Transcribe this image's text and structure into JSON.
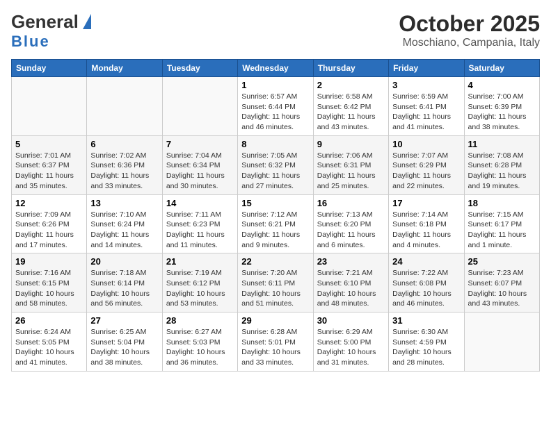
{
  "header": {
    "logo_general": "General",
    "logo_blue": "Blue",
    "month_title": "October 2025",
    "location": "Moschiano, Campania, Italy"
  },
  "weekdays": [
    "Sunday",
    "Monday",
    "Tuesday",
    "Wednesday",
    "Thursday",
    "Friday",
    "Saturday"
  ],
  "weeks": [
    [
      {
        "day": "",
        "sunrise": "",
        "sunset": "",
        "daylight": ""
      },
      {
        "day": "",
        "sunrise": "",
        "sunset": "",
        "daylight": ""
      },
      {
        "day": "",
        "sunrise": "",
        "sunset": "",
        "daylight": ""
      },
      {
        "day": "1",
        "sunrise": "6:57 AM",
        "sunset": "6:44 PM",
        "daylight": "11 hours and 46 minutes."
      },
      {
        "day": "2",
        "sunrise": "6:58 AM",
        "sunset": "6:42 PM",
        "daylight": "11 hours and 43 minutes."
      },
      {
        "day": "3",
        "sunrise": "6:59 AM",
        "sunset": "6:41 PM",
        "daylight": "11 hours and 41 minutes."
      },
      {
        "day": "4",
        "sunrise": "7:00 AM",
        "sunset": "6:39 PM",
        "daylight": "11 hours and 38 minutes."
      }
    ],
    [
      {
        "day": "5",
        "sunrise": "7:01 AM",
        "sunset": "6:37 PM",
        "daylight": "11 hours and 35 minutes."
      },
      {
        "day": "6",
        "sunrise": "7:02 AM",
        "sunset": "6:36 PM",
        "daylight": "11 hours and 33 minutes."
      },
      {
        "day": "7",
        "sunrise": "7:04 AM",
        "sunset": "6:34 PM",
        "daylight": "11 hours and 30 minutes."
      },
      {
        "day": "8",
        "sunrise": "7:05 AM",
        "sunset": "6:32 PM",
        "daylight": "11 hours and 27 minutes."
      },
      {
        "day": "9",
        "sunrise": "7:06 AM",
        "sunset": "6:31 PM",
        "daylight": "11 hours and 25 minutes."
      },
      {
        "day": "10",
        "sunrise": "7:07 AM",
        "sunset": "6:29 PM",
        "daylight": "11 hours and 22 minutes."
      },
      {
        "day": "11",
        "sunrise": "7:08 AM",
        "sunset": "6:28 PM",
        "daylight": "11 hours and 19 minutes."
      }
    ],
    [
      {
        "day": "12",
        "sunrise": "7:09 AM",
        "sunset": "6:26 PM",
        "daylight": "11 hours and 17 minutes."
      },
      {
        "day": "13",
        "sunrise": "7:10 AM",
        "sunset": "6:24 PM",
        "daylight": "11 hours and 14 minutes."
      },
      {
        "day": "14",
        "sunrise": "7:11 AM",
        "sunset": "6:23 PM",
        "daylight": "11 hours and 11 minutes."
      },
      {
        "day": "15",
        "sunrise": "7:12 AM",
        "sunset": "6:21 PM",
        "daylight": "11 hours and 9 minutes."
      },
      {
        "day": "16",
        "sunrise": "7:13 AM",
        "sunset": "6:20 PM",
        "daylight": "11 hours and 6 minutes."
      },
      {
        "day": "17",
        "sunrise": "7:14 AM",
        "sunset": "6:18 PM",
        "daylight": "11 hours and 4 minutes."
      },
      {
        "day": "18",
        "sunrise": "7:15 AM",
        "sunset": "6:17 PM",
        "daylight": "11 hours and 1 minute."
      }
    ],
    [
      {
        "day": "19",
        "sunrise": "7:16 AM",
        "sunset": "6:15 PM",
        "daylight": "10 hours and 58 minutes."
      },
      {
        "day": "20",
        "sunrise": "7:18 AM",
        "sunset": "6:14 PM",
        "daylight": "10 hours and 56 minutes."
      },
      {
        "day": "21",
        "sunrise": "7:19 AM",
        "sunset": "6:12 PM",
        "daylight": "10 hours and 53 minutes."
      },
      {
        "day": "22",
        "sunrise": "7:20 AM",
        "sunset": "6:11 PM",
        "daylight": "10 hours and 51 minutes."
      },
      {
        "day": "23",
        "sunrise": "7:21 AM",
        "sunset": "6:10 PM",
        "daylight": "10 hours and 48 minutes."
      },
      {
        "day": "24",
        "sunrise": "7:22 AM",
        "sunset": "6:08 PM",
        "daylight": "10 hours and 46 minutes."
      },
      {
        "day": "25",
        "sunrise": "7:23 AM",
        "sunset": "6:07 PM",
        "daylight": "10 hours and 43 minutes."
      }
    ],
    [
      {
        "day": "26",
        "sunrise": "6:24 AM",
        "sunset": "5:05 PM",
        "daylight": "10 hours and 41 minutes."
      },
      {
        "day": "27",
        "sunrise": "6:25 AM",
        "sunset": "5:04 PM",
        "daylight": "10 hours and 38 minutes."
      },
      {
        "day": "28",
        "sunrise": "6:27 AM",
        "sunset": "5:03 PM",
        "daylight": "10 hours and 36 minutes."
      },
      {
        "day": "29",
        "sunrise": "6:28 AM",
        "sunset": "5:01 PM",
        "daylight": "10 hours and 33 minutes."
      },
      {
        "day": "30",
        "sunrise": "6:29 AM",
        "sunset": "5:00 PM",
        "daylight": "10 hours and 31 minutes."
      },
      {
        "day": "31",
        "sunrise": "6:30 AM",
        "sunset": "4:59 PM",
        "daylight": "10 hours and 28 minutes."
      },
      {
        "day": "",
        "sunrise": "",
        "sunset": "",
        "daylight": ""
      }
    ]
  ],
  "labels": {
    "sunrise_prefix": "Sunrise: ",
    "sunset_prefix": "Sunset: ",
    "daylight_prefix": "Daylight: "
  }
}
